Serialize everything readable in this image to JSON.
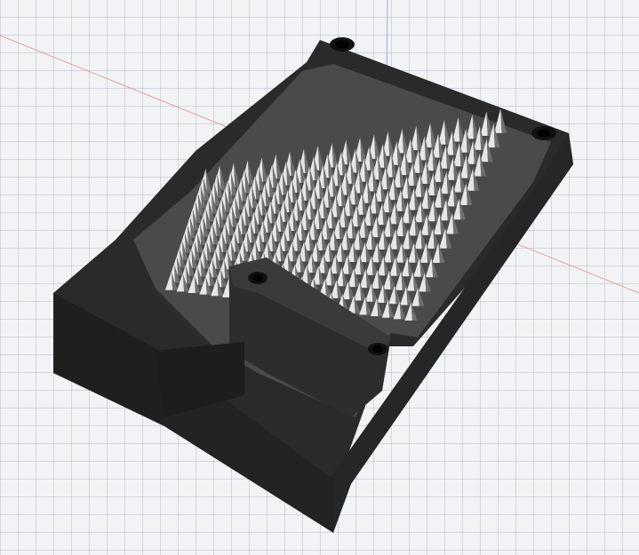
{
  "viewport": {
    "background": "#f2f3f5",
    "grid_color": "#b9c0cc",
    "axis_x_color": "#d9a3a3",
    "axis_z_color": "#8fb0e6"
  },
  "model": {
    "body_color": "#2b2b2b",
    "body_dark": "#1e1e1e",
    "body_edge": "#3a3a3a",
    "spike_light": "#e6e6e6",
    "spike_mid": "#b7b7b7",
    "spike_dark": "#6f6f6f",
    "icons": [
      "box-model-icon",
      "spike-field-icon",
      "screw-hole-icon"
    ]
  }
}
